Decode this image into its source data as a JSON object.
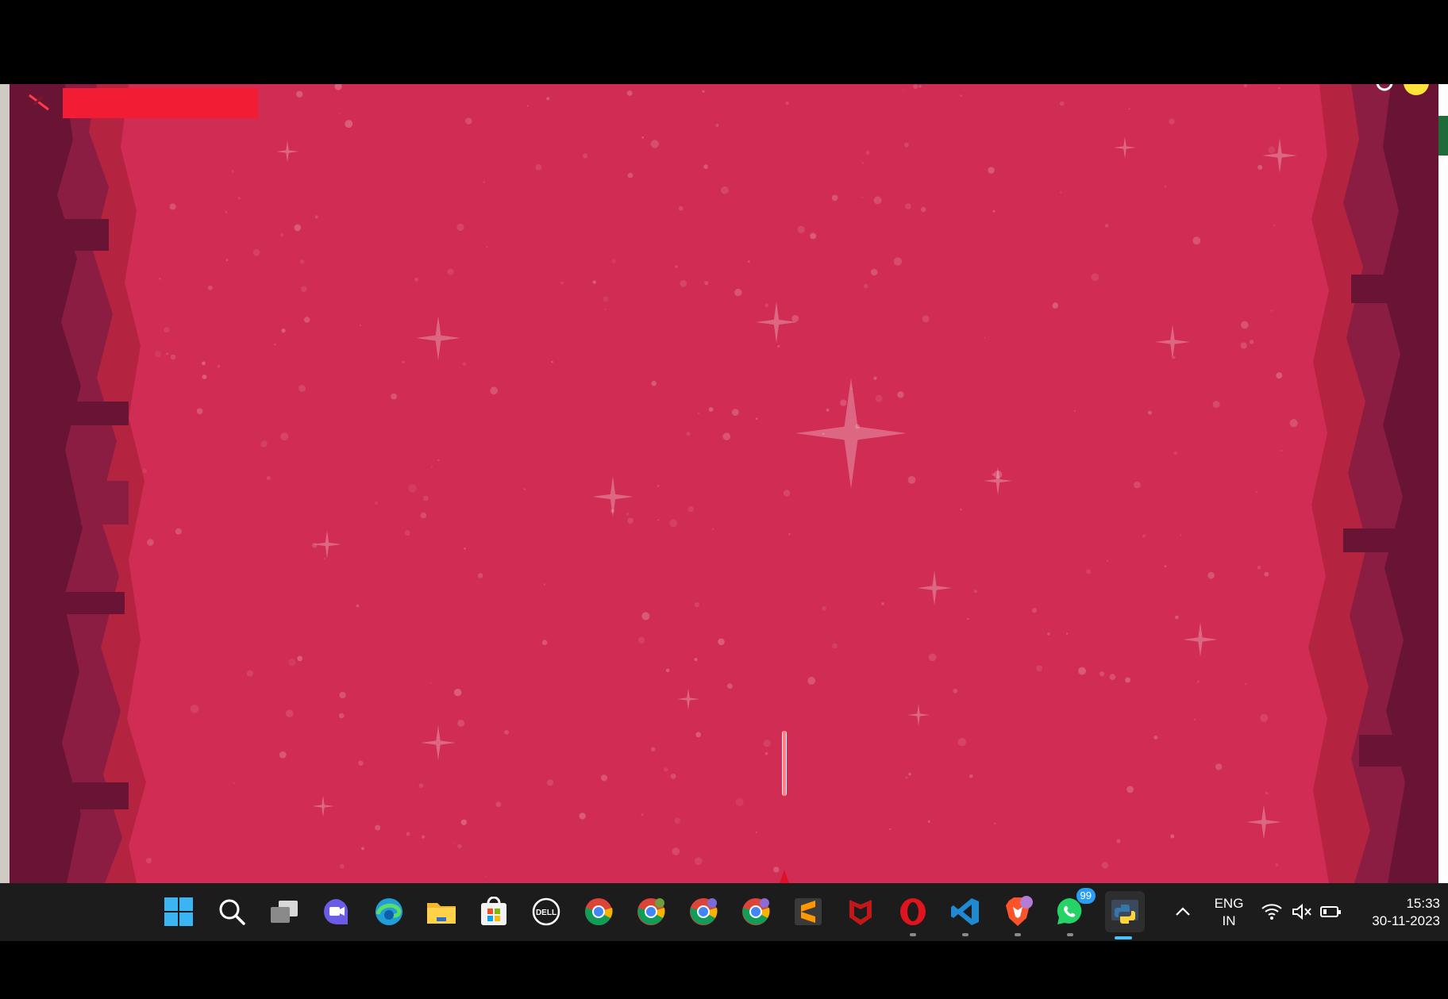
{
  "game": {
    "health_bar_color": "#f21d34",
    "background_color": "#d02c54",
    "rock_dark": "#6a1435",
    "rock_mid": "#8c1d42",
    "rock_light": "#b4233f",
    "laser_color": "#ff2a36"
  },
  "taskbar": {
    "icons": [
      {
        "name": "start-windows-icon"
      },
      {
        "name": "search-icon"
      },
      {
        "name": "task-view-icon"
      },
      {
        "name": "teams-chat-icon"
      },
      {
        "name": "edge-browser-icon"
      },
      {
        "name": "file-explorer-icon"
      },
      {
        "name": "microsoft-store-icon"
      },
      {
        "name": "dell-icon"
      },
      {
        "name": "chrome-icon"
      },
      {
        "name": "chrome-profile-icon"
      },
      {
        "name": "chrome-profile-icon"
      },
      {
        "name": "chrome-profile-icon"
      },
      {
        "name": "sublime-text-icon"
      },
      {
        "name": "mcafee-icon"
      },
      {
        "name": "opera-icon"
      },
      {
        "name": "vscode-icon"
      },
      {
        "name": "brave-icon"
      },
      {
        "name": "whatsapp-icon"
      },
      {
        "name": "python-icon"
      }
    ],
    "whatsapp_badge": "99",
    "language_line1": "ENG",
    "language_line2": "IN",
    "time": "15:33",
    "date": "30-11-2023"
  }
}
